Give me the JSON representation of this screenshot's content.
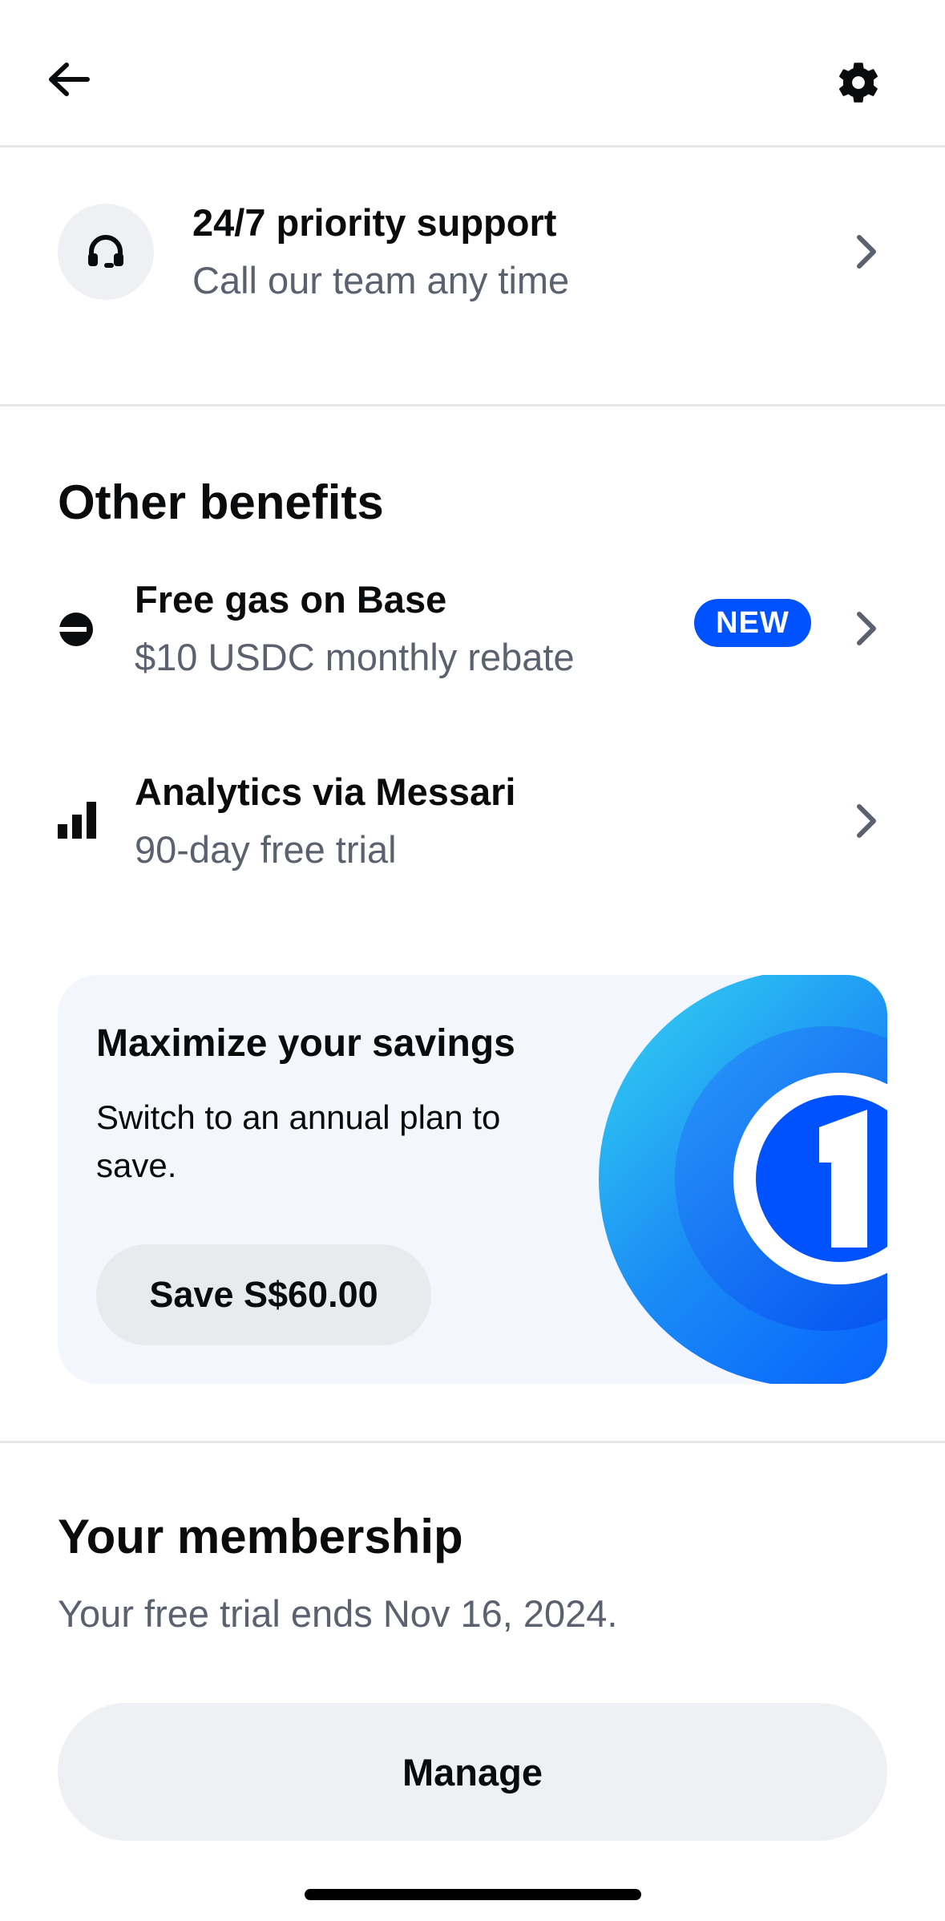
{
  "header": {
    "back_icon": "arrow-left-icon",
    "settings_icon": "gear-icon"
  },
  "support": {
    "icon": "headset-icon",
    "title": "24/7 priority support",
    "subtitle": "Call our team any time"
  },
  "other_benefits": {
    "heading": "Other benefits",
    "items": [
      {
        "icon": "base-logo-icon",
        "title": "Free gas on Base",
        "subtitle": "$10 USDC monthly rebate",
        "badge": "NEW"
      },
      {
        "icon": "bar-chart-icon",
        "title": "Analytics via Messari",
        "subtitle": "90-day free trial"
      }
    ]
  },
  "promo": {
    "title": "Maximize your savings",
    "text": "Switch to an annual plan to save.",
    "button_label": "Save S$60.00",
    "art_icon": "coinbase-one-logo-icon"
  },
  "membership": {
    "heading": "Your membership",
    "text": "Your free trial ends Nov 16, 2024.",
    "button_label": "Manage"
  },
  "colors": {
    "accent": "#0052ff",
    "text_primary": "#0a0b0d",
    "text_secondary": "#5b616e",
    "surface": "#eef0f3",
    "card": "#f3f6fd"
  }
}
